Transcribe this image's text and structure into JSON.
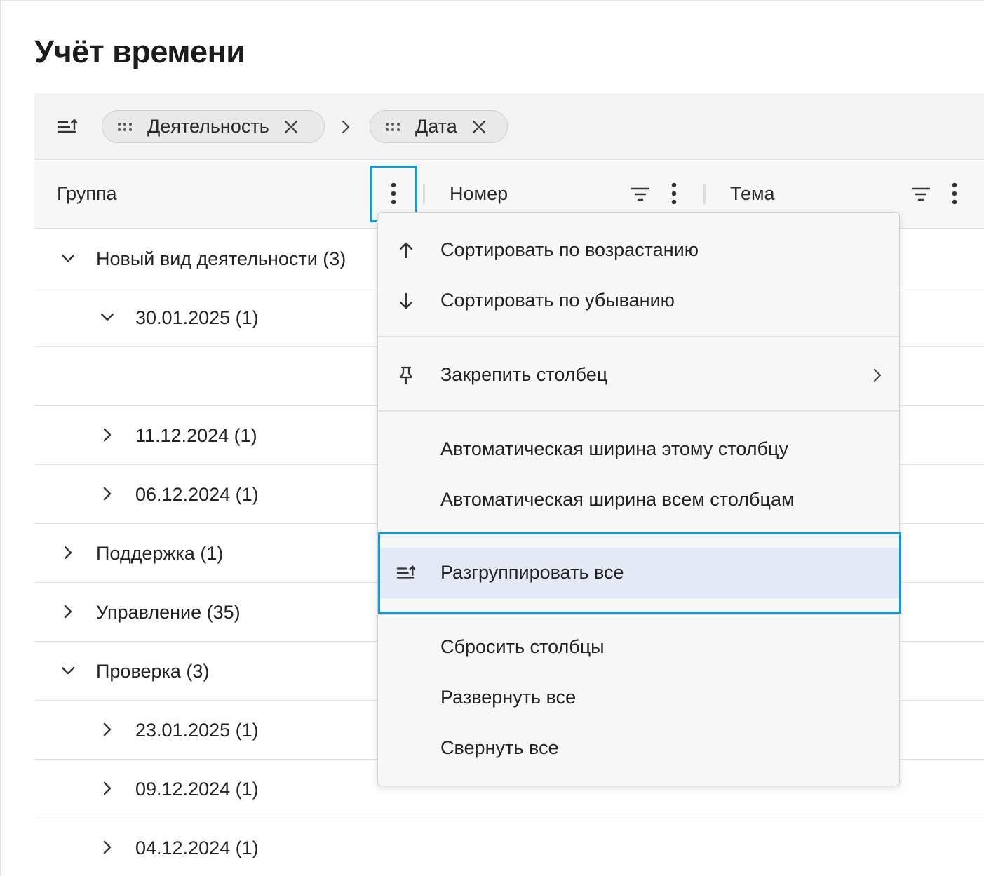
{
  "page": {
    "title": "Учёт времени"
  },
  "group_bar": {
    "chips": [
      {
        "label": "Деятельность"
      },
      {
        "label": "Дата"
      }
    ]
  },
  "columns": [
    {
      "label": "Группа"
    },
    {
      "label": "Номер"
    },
    {
      "label": "Тема"
    }
  ],
  "rows": [
    {
      "label": "Новый вид деятельности (3)",
      "level": 1,
      "expanded": true
    },
    {
      "label": "30.01.2025 (1)",
      "level": 2,
      "expanded": true
    },
    {
      "label": "",
      "level": 3
    },
    {
      "label": "11.12.2024 (1)",
      "level": 2,
      "expanded": false
    },
    {
      "label": "06.12.2024 (1)",
      "level": 2,
      "expanded": false
    },
    {
      "label": "Поддержка (1)",
      "level": 1,
      "expanded": false
    },
    {
      "label": "Управление (35)",
      "level": 1,
      "expanded": false
    },
    {
      "label": "Проверка (3)",
      "level": 1,
      "expanded": true
    },
    {
      "label": "23.01.2025 (1)",
      "level": 2,
      "expanded": false
    },
    {
      "label": "09.12.2024 (1)",
      "level": 2,
      "expanded": false
    },
    {
      "label": "04.12.2024 (1)",
      "level": 2,
      "expanded": false
    }
  ],
  "column_menu": {
    "items": [
      {
        "label": "Сортировать по возрастанию",
        "icon": "arrow-up-icon"
      },
      {
        "label": "Сортировать по убыванию",
        "icon": "arrow-down-icon"
      },
      {
        "label": "Закрепить столбец",
        "icon": "pin-icon",
        "submenu": true
      },
      {
        "label": "Автоматическая ширина этому столбцу"
      },
      {
        "label": "Автоматическая ширина всем столбцам"
      },
      {
        "label": "Разгруппировать все",
        "icon": "ungroup-icon",
        "active": true
      },
      {
        "label": "Сбросить столбцы"
      },
      {
        "label": "Развернуть все"
      },
      {
        "label": "Свернуть все"
      }
    ]
  },
  "colors": {
    "accent_highlight": "#0d9be0",
    "active_item_bg": "#e3eaf6"
  }
}
